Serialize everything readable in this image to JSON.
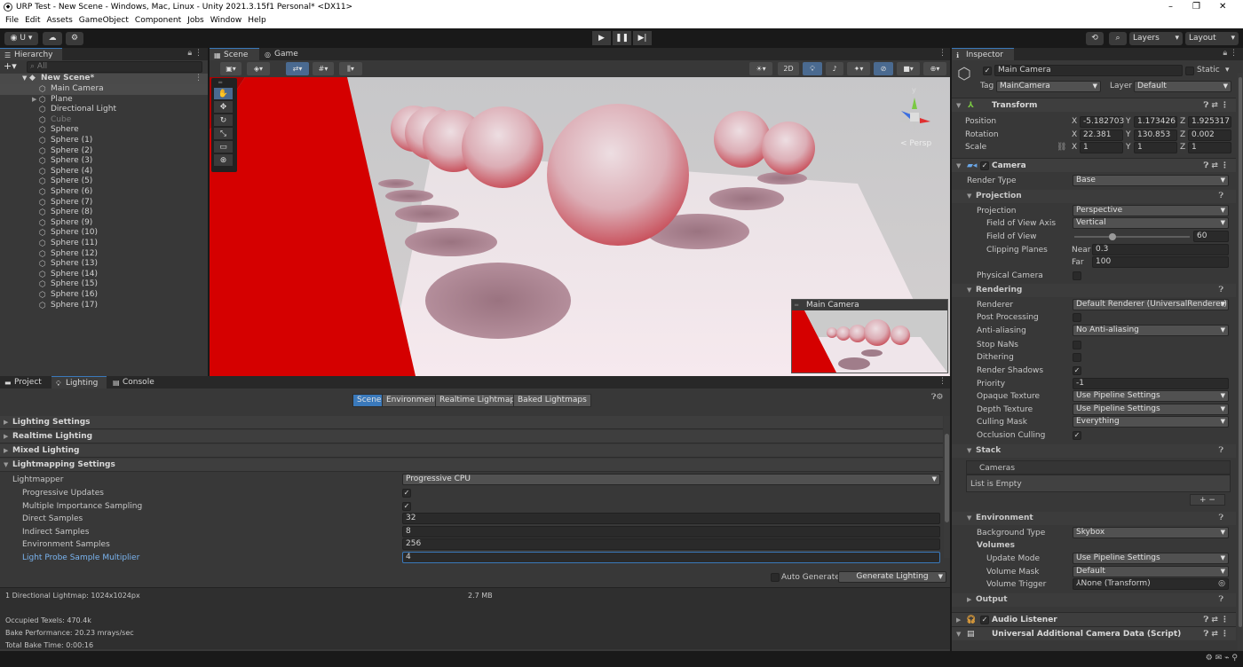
{
  "window": {
    "title": "URP Test - New Scene - Windows, Mac, Linux - Unity 2021.3.15f1 Personal* <DX11>"
  },
  "menu": [
    "File",
    "Edit",
    "Assets",
    "GameObject",
    "Component",
    "Jobs",
    "Window",
    "Help"
  ],
  "toolbar": {
    "account": "U",
    "layers": "Layers",
    "layout": "Layout"
  },
  "hierarchy": {
    "tab": "Hierarchy",
    "search_placeholder": "All",
    "scene": "New Scene*",
    "items": [
      "Main Camera",
      "Plane",
      "Directional Light",
      "Cube",
      "Sphere",
      "Sphere (1)",
      "Sphere (2)",
      "Sphere (3)",
      "Sphere (4)",
      "Sphere (5)",
      "Sphere (6)",
      "Sphere (7)",
      "Sphere (8)",
      "Sphere (9)",
      "Sphere (10)",
      "Sphere (11)",
      "Sphere (12)",
      "Sphere (13)",
      "Sphere (14)",
      "Sphere (15)",
      "Sphere (16)",
      "Sphere (17)"
    ]
  },
  "scene": {
    "tabs": [
      "Scene",
      "Game"
    ],
    "btn_2d": "2D",
    "persp": "Persp",
    "gizmo_y": "y",
    "overlay_title": "Main Camera"
  },
  "bottom": {
    "tabs": [
      "Project",
      "Lighting",
      "Console"
    ],
    "subtabs": [
      "Scene",
      "Environment",
      "Realtime Lightmaps",
      "Baked Lightmaps"
    ],
    "sections": [
      "Lighting Settings",
      "Realtime Lighting",
      "Mixed Lighting",
      "Lightmapping Settings"
    ],
    "lightmapper_label": "Lightmapper",
    "lightmapper_value": "Progressive CPU",
    "rows": [
      {
        "label": "Progressive Updates",
        "value": "✓"
      },
      {
        "label": "Multiple Importance Sampling",
        "value": "✓"
      },
      {
        "label": "Direct Samples",
        "value": "32"
      },
      {
        "label": "Indirect Samples",
        "value": "8"
      },
      {
        "label": "Environment Samples",
        "value": "256"
      },
      {
        "label": "Light Probe Sample Multiplier",
        "value": "4"
      }
    ],
    "auto_generate": "Auto Generate",
    "generate": "Generate Lighting",
    "stats": {
      "lightmap": "1 Directional Lightmap: 1024x1024px",
      "size": "2.7 MB",
      "texels": "Occupied Texels: 470.4k",
      "perf": "Bake Performance: 20.23 mrays/sec",
      "time": "Total Bake Time: 0:00:16"
    }
  },
  "inspector": {
    "tab": "Inspector",
    "object_name": "Main Camera",
    "static": "Static",
    "tag_label": "Tag",
    "tag": "MainCamera",
    "layer_label": "Layer",
    "layer": "Default",
    "transform": {
      "title": "Transform",
      "position_label": "Position",
      "px": "-5.182703",
      "py": "1.173426",
      "pz": "1.925317",
      "rotation_label": "Rotation",
      "rx": "22.381",
      "ry": "130.853",
      "rz": "0.002",
      "scale_label": "Scale",
      "sx": "1",
      "sy": "1",
      "sz": "1",
      "X": "X",
      "Y": "Y",
      "Z": "Z"
    },
    "camera": {
      "title": "Camera",
      "render_type_label": "Render Type",
      "render_type": "Base",
      "projection_section": "Projection",
      "projection_label": "Projection",
      "projection": "Perspective",
      "fov_axis_label": "Field of View Axis",
      "fov_axis": "Vertical",
      "fov_label": "Field of View",
      "fov": "60",
      "fov_fraction": 0.33,
      "clip_label": "Clipping Planes",
      "near_label": "Near",
      "near": "0.3",
      "far_label": "Far",
      "far": "100",
      "physical_label": "Physical Camera",
      "rendering_section": "Rendering",
      "renderer_label": "Renderer",
      "renderer": "Default Renderer (UniversalRenderer)",
      "post_label": "Post Processing",
      "aa_label": "Anti-aliasing",
      "aa": "No Anti-aliasing",
      "nan_label": "Stop NaNs",
      "dither_label": "Dithering",
      "shadows_label": "Render Shadows",
      "priority_label": "Priority",
      "priority": "-1",
      "opaque_label": "Opaque Texture",
      "opaque": "Use Pipeline Settings",
      "depth_label": "Depth Texture",
      "depth": "Use Pipeline Settings",
      "cull_label": "Culling Mask",
      "cull": "Everything",
      "occl_label": "Occlusion Culling",
      "stack_section": "Stack",
      "cameras_label": "Cameras",
      "list_empty": "List is Empty",
      "env_section": "Environment",
      "bg_label": "Background Type",
      "bg": "Skybox",
      "volumes_label": "Volumes",
      "update_label": "Update Mode",
      "update": "Use Pipeline Settings",
      "vmask_label": "Volume Mask",
      "vmask": "Default",
      "vtrig_label": "Volume Trigger",
      "vtrig": "None (Transform)",
      "output_section": "Output"
    },
    "audio_listener": "Audio Listener",
    "uacd": "Universal Additional Camera Data (Script)"
  },
  "colors": {
    "accent": "#3a79bb",
    "panel": "#383838",
    "dark": "#191919",
    "red": "#e01010"
  }
}
